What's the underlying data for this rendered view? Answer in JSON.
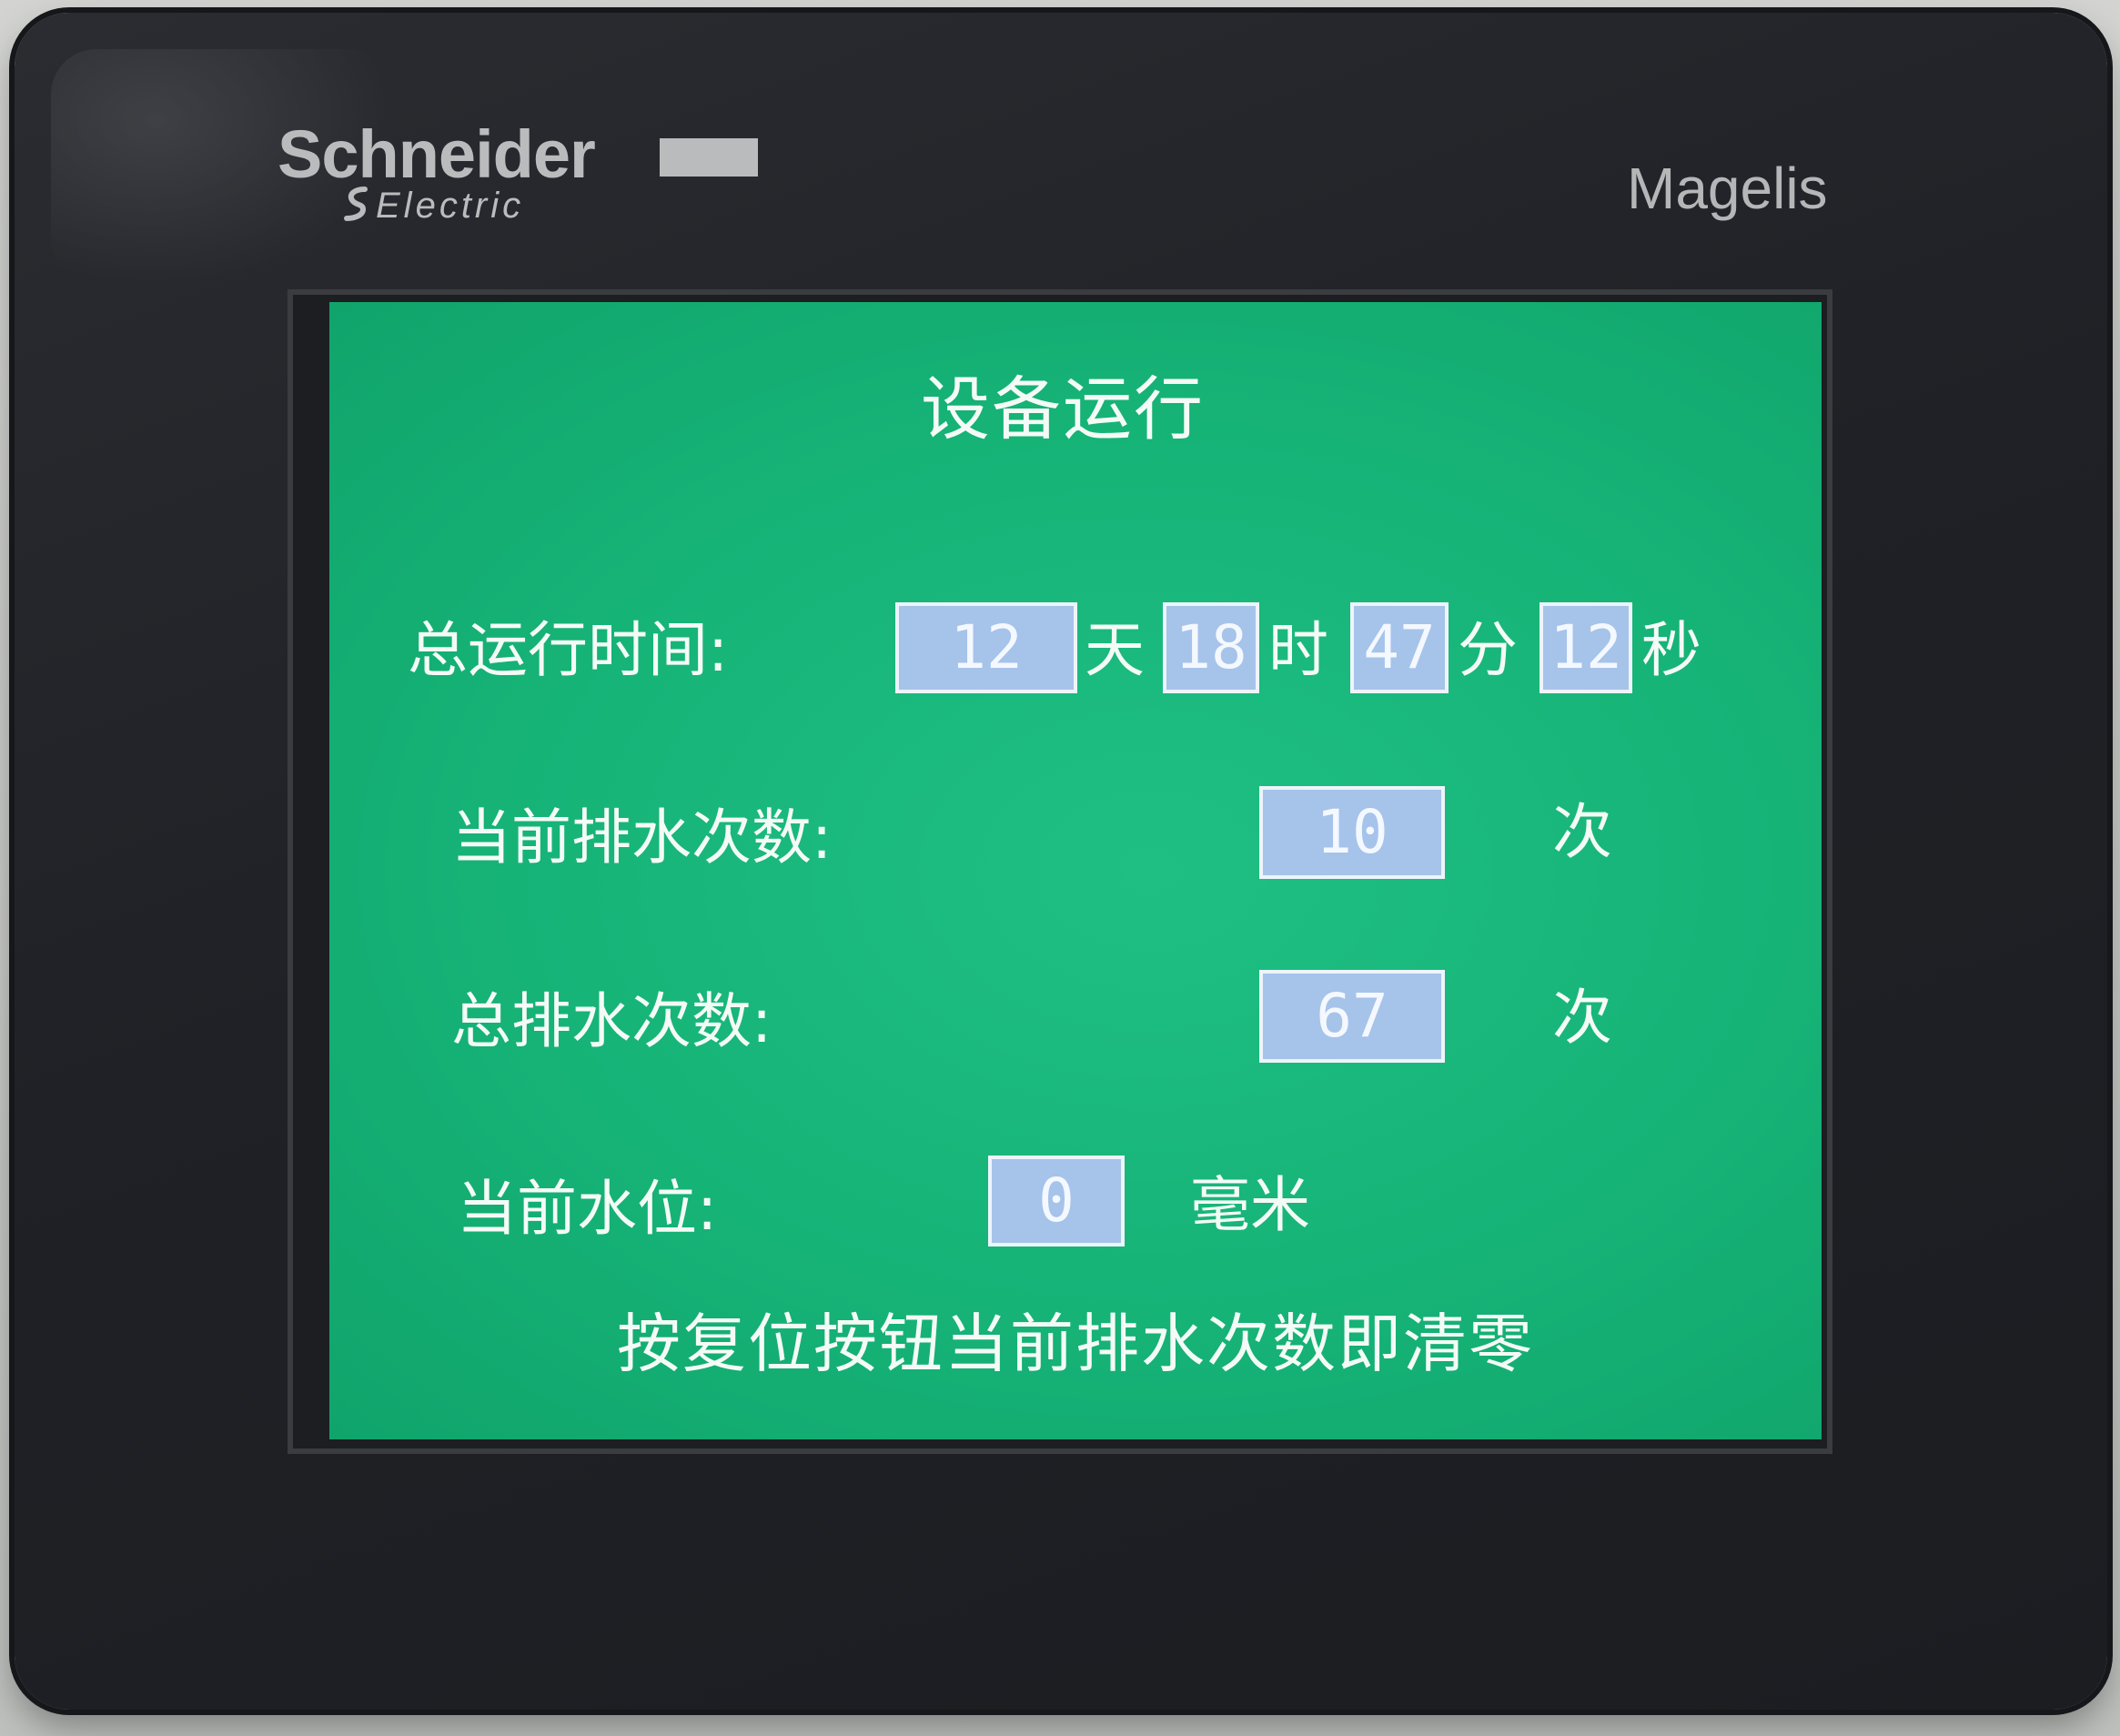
{
  "device": {
    "brand": "Schneider",
    "brand_sub": "Electric",
    "model": "Magelis"
  },
  "screen": {
    "title": "设备运行",
    "runtime": {
      "label": "总运行时间:",
      "days": "12",
      "days_unit": "天",
      "hours": "18",
      "hours_unit": "时",
      "minutes": "47",
      "minutes_unit": "分",
      "seconds": "12",
      "seconds_unit": "秒"
    },
    "current_drain": {
      "label": "当前排水次数:",
      "value": "10",
      "unit": "次"
    },
    "total_drain": {
      "label": "总排水次数:",
      "value": "67",
      "unit": "次"
    },
    "water_level": {
      "label": "当前水位:",
      "value": "0",
      "unit": "毫米"
    },
    "note": "按复位按钮当前排水次数即清零"
  },
  "colors": {
    "screen_background": "#16b377",
    "field_background": "#a6c3ea",
    "text": "#f4fbf7",
    "bezel": "#1f2126"
  }
}
